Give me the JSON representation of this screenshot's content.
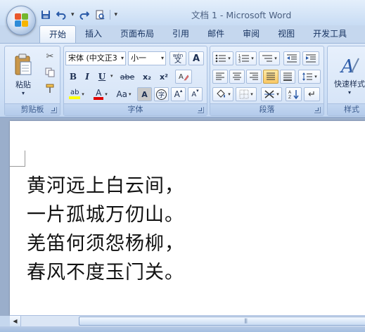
{
  "window": {
    "title": "文档 1 - Microsoft Word"
  },
  "quick_access": {
    "icons": [
      "save-icon",
      "undo-icon",
      "redo-icon",
      "print-preview-icon"
    ]
  },
  "tabs": [
    {
      "label": "开始",
      "active": true
    },
    {
      "label": "插入"
    },
    {
      "label": "页面布局"
    },
    {
      "label": "引用"
    },
    {
      "label": "邮件"
    },
    {
      "label": "审阅"
    },
    {
      "label": "视图"
    },
    {
      "label": "开发工具"
    }
  ],
  "ribbon": {
    "clipboard": {
      "label": "剪贴板",
      "paste_label": "粘贴"
    },
    "font": {
      "label": "字体",
      "font_name": "宋体 (中文正3",
      "font_size": "小一",
      "bold": "B",
      "italic": "I",
      "underline": "U",
      "strike": "abe",
      "subscript": "x₂",
      "superscript": "x²",
      "phonetic": "wén",
      "phonetic_char": "文",
      "char_border": "A",
      "case": "Aa",
      "shading": "A",
      "enclose": "字",
      "grow": "A",
      "shrink": "A",
      "font_color": "A",
      "highlight": "ab",
      "highlight_color": "#ffff00",
      "font_color_value": "#e00000"
    },
    "paragraph": {
      "label": "段落"
    },
    "styles": {
      "label": "样式",
      "quick_styles_label": "快速样式"
    }
  },
  "document": {
    "poem_lines": [
      "黄河远上白云间，",
      "一片孤城万仞山。",
      "羌笛何须怨杨柳，",
      "春风不度玉门关。"
    ]
  }
}
